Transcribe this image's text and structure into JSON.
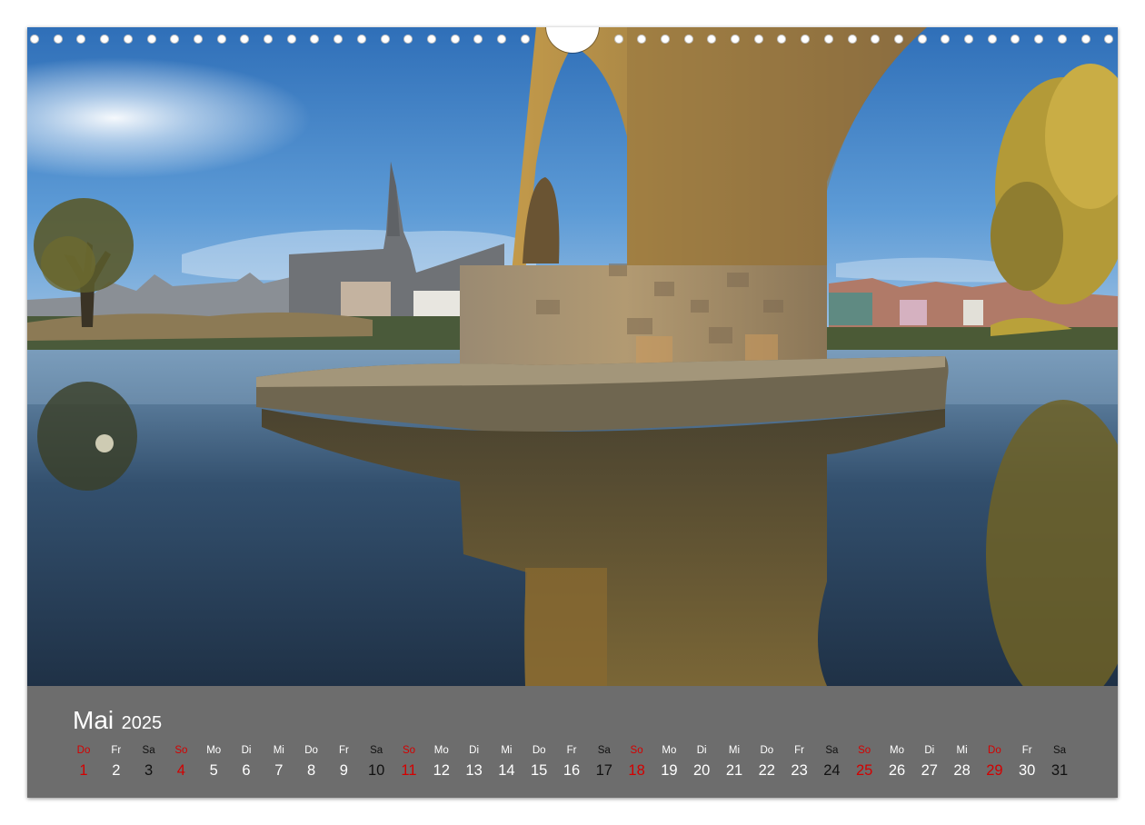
{
  "calendar": {
    "month": "Mai",
    "year": "2025",
    "days": [
      {
        "wd": "Do",
        "n": "1",
        "kind": "holiday"
      },
      {
        "wd": "Fr",
        "n": "2",
        "kind": "normal"
      },
      {
        "wd": "Sa",
        "n": "3",
        "kind": "sat"
      },
      {
        "wd": "So",
        "n": "4",
        "kind": "holiday"
      },
      {
        "wd": "Mo",
        "n": "5",
        "kind": "normal"
      },
      {
        "wd": "Di",
        "n": "6",
        "kind": "normal"
      },
      {
        "wd": "Mi",
        "n": "7",
        "kind": "normal"
      },
      {
        "wd": "Do",
        "n": "8",
        "kind": "normal"
      },
      {
        "wd": "Fr",
        "n": "9",
        "kind": "normal"
      },
      {
        "wd": "Sa",
        "n": "10",
        "kind": "sat"
      },
      {
        "wd": "So",
        "n": "11",
        "kind": "holiday"
      },
      {
        "wd": "Mo",
        "n": "12",
        "kind": "normal"
      },
      {
        "wd": "Di",
        "n": "13",
        "kind": "normal"
      },
      {
        "wd": "Mi",
        "n": "14",
        "kind": "normal"
      },
      {
        "wd": "Do",
        "n": "15",
        "kind": "normal"
      },
      {
        "wd": "Fr",
        "n": "16",
        "kind": "normal"
      },
      {
        "wd": "Sa",
        "n": "17",
        "kind": "sat"
      },
      {
        "wd": "So",
        "n": "18",
        "kind": "holiday"
      },
      {
        "wd": "Mo",
        "n": "19",
        "kind": "normal"
      },
      {
        "wd": "Di",
        "n": "20",
        "kind": "normal"
      },
      {
        "wd": "Mi",
        "n": "21",
        "kind": "normal"
      },
      {
        "wd": "Do",
        "n": "22",
        "kind": "normal"
      },
      {
        "wd": "Fr",
        "n": "23",
        "kind": "normal"
      },
      {
        "wd": "Sa",
        "n": "24",
        "kind": "sat"
      },
      {
        "wd": "So",
        "n": "25",
        "kind": "holiday"
      },
      {
        "wd": "Mo",
        "n": "26",
        "kind": "normal"
      },
      {
        "wd": "Di",
        "n": "27",
        "kind": "normal"
      },
      {
        "wd": "Mi",
        "n": "28",
        "kind": "normal"
      },
      {
        "wd": "Do",
        "n": "29",
        "kind": "holiday"
      },
      {
        "wd": "Fr",
        "n": "30",
        "kind": "normal"
      },
      {
        "wd": "Sa",
        "n": "31",
        "kind": "sat"
      }
    ]
  },
  "colors": {
    "calendar_bg": "#6d6d6d",
    "holiday": "#d40000",
    "saturday": "#111111",
    "weekday": "#ffffff"
  }
}
